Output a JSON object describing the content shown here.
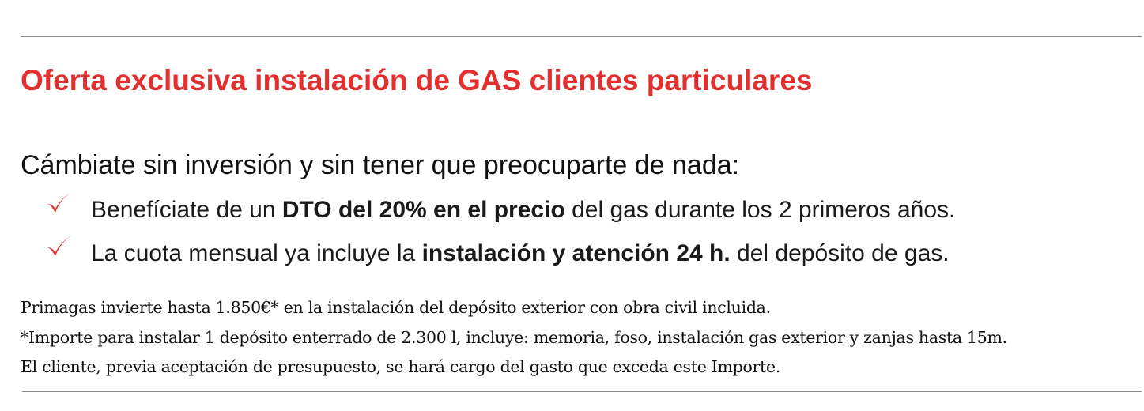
{
  "title": "Oferta exclusiva instalación de GAS clientes particulares",
  "intro": "Cámbiate sin inversión y sin tener que preocuparte de nada:",
  "accent_color": "#e1302f",
  "bullet_icon": "checkmark-icon",
  "bullets": [
    {
      "before": "Benefíciate de un ",
      "bold": "DTO del 20% en el precio",
      "after": " del gas durante los 2 primeros años."
    },
    {
      "before": "La cuota mensual ya incluye la ",
      "bold": "instalación y atención 24 h.",
      "after": " del depósito de gas."
    }
  ],
  "notes": [
    "Primagas invierte hasta 1.850€* en la instalación del depósito exterior con obra civil incluida.",
    "*Importe para instalar 1 depósito enterrado de 2.300 l, incluye: memoria, foso, instalación gas exterior y zanjas hasta 15m.",
    "El cliente, previa aceptación de presupuesto, se hará cargo del gasto que exceda este Importe."
  ]
}
